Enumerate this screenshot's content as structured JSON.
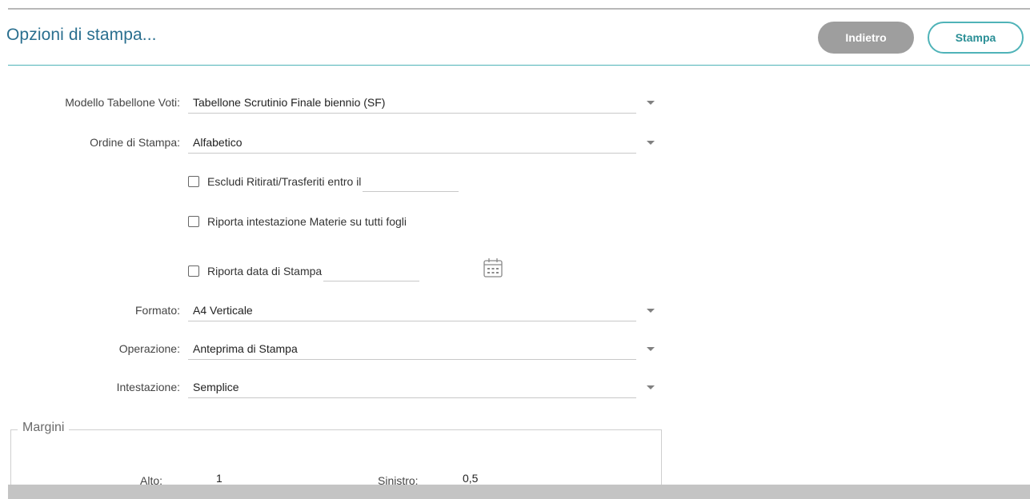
{
  "header": {
    "title": "Opzioni di stampa...",
    "back_label": "Indietro",
    "print_label": "Stampa"
  },
  "form": {
    "modello": {
      "label": "Modello Tabellone Voti:",
      "value": "Tabellone Scrutinio Finale biennio (SF)"
    },
    "ordine": {
      "label": "Ordine di Stampa:",
      "value": "Alfabetico"
    },
    "escludi": {
      "label": "Escludi Ritirati/Trasferiti entro il",
      "checked": false,
      "value": ""
    },
    "riporta_intestazione": {
      "label": "Riporta intestazione Materie su tutti fogli",
      "checked": false
    },
    "riporta_data": {
      "label": "Riporta data di Stampa",
      "checked": false,
      "value": ""
    },
    "formato": {
      "label": "Formato:",
      "value": "A4 Verticale"
    },
    "operazione": {
      "label": "Operazione:",
      "value": "Anteprima di Stampa"
    },
    "intestazione": {
      "label": "Intestazione:",
      "value": "Semplice"
    }
  },
  "margini": {
    "legend": "Margini",
    "alto_label": "Alto:",
    "alto_value": "1",
    "sinistro_label": "Sinistro:",
    "sinistro_value": "0,5"
  },
  "icons": {
    "caret": "chevron-down-icon",
    "calendar": "calendar-icon"
  },
  "colors": {
    "accent": "#4fb3b8",
    "title": "#2a6f8f",
    "button_secondary": "#9e9e9e"
  }
}
